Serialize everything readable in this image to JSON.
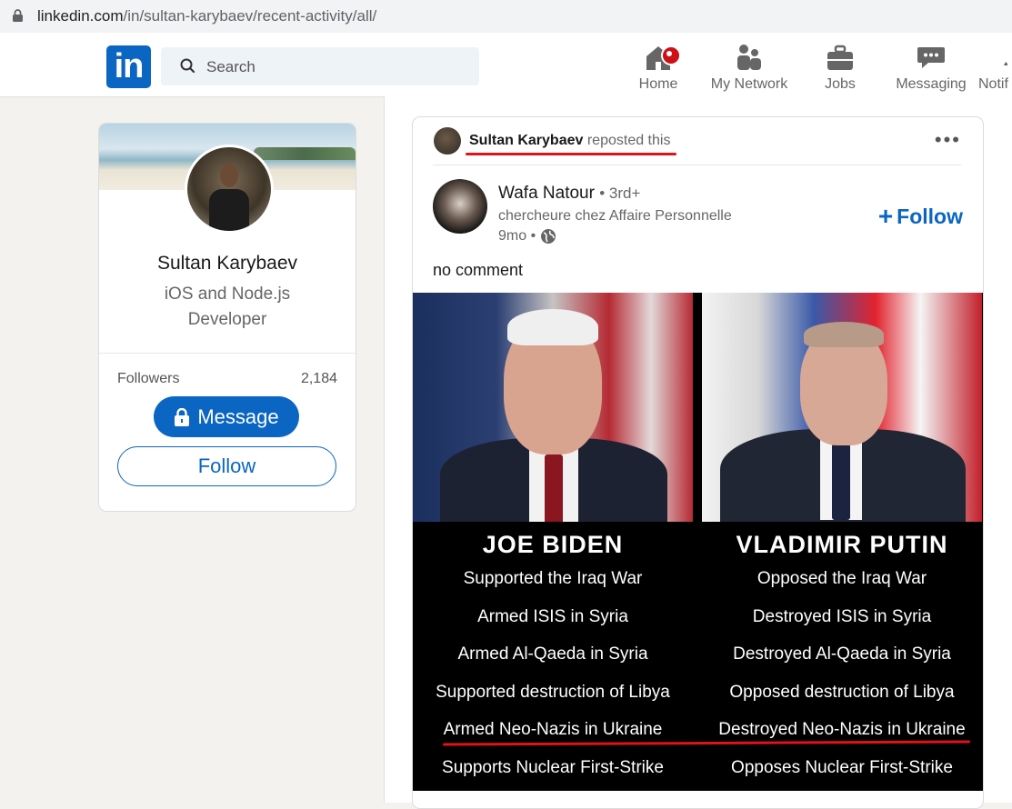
{
  "browser": {
    "url_host": "linkedin.com",
    "url_path": "/in/sultan-karybaev/recent-activity/all/"
  },
  "nav": {
    "logo": "in",
    "search_placeholder": "Search",
    "items": [
      {
        "label": "Home"
      },
      {
        "label": "My Network"
      },
      {
        "label": "Jobs"
      },
      {
        "label": "Messaging"
      },
      {
        "label": "Notif"
      }
    ]
  },
  "profile": {
    "name": "Sultan Karybaev",
    "headline": "iOS and Node.js Developer",
    "followers_label": "Followers",
    "followers_count": "2,184",
    "message_label": "Message",
    "follow_label": "Follow"
  },
  "post": {
    "reposter": "Sultan Karybaev",
    "repost_text": "reposted this",
    "author": "Wafa Natour",
    "degree": "• 3rd+",
    "author_headline": "chercheure chez Affaire Personnelle",
    "time": "9mo •",
    "follow_label": "Follow",
    "text": "no comment",
    "meme": {
      "left": {
        "title": "JOE BIDEN",
        "lines": [
          "Supported the Iraq War",
          "Armed ISIS in Syria",
          "Armed Al-Qaeda in Syria",
          "Supported destruction of Libya",
          "Armed Neo-Nazis in Ukraine",
          "Supports Nuclear First-Strike"
        ]
      },
      "right": {
        "title": "VLADIMIR PUTIN",
        "lines": [
          "Opposed the Iraq War",
          "Destroyed ISIS in Syria",
          "Destroyed Al-Qaeda in Syria",
          "Opposed destruction of Libya",
          "Destroyed Neo-Nazis in Ukraine",
          "Opposes Nuclear First-Strike"
        ]
      }
    }
  },
  "colors": {
    "brand": "#0a66c2",
    "annotation_red": "#e0121b",
    "notification_red": "#cc1016"
  }
}
